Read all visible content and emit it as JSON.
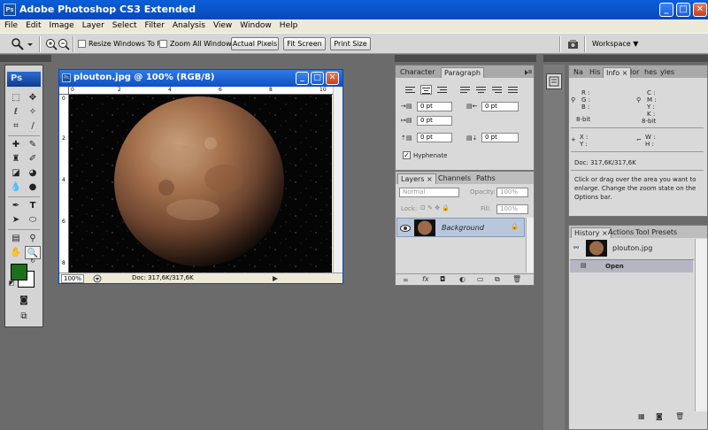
{
  "window": {
    "title": "Adobe Photoshop CS3 Extended",
    "logo": "Ps",
    "min": "_",
    "max": "□",
    "close": "✕"
  },
  "menu": [
    "File",
    "Edit",
    "Image",
    "Layer",
    "Select",
    "Filter",
    "Analysis",
    "View",
    "Window",
    "Help"
  ],
  "options": {
    "resize_windows": "Resize Windows To Fit",
    "zoom_all": "Zoom All Windows",
    "actual_pixels": "Actual Pixels",
    "fit_screen": "Fit Screen",
    "print_size": "Print Size",
    "workspace": "Workspace ▼"
  },
  "toolbox": {
    "logo": "Ps"
  },
  "document": {
    "title": "plouton.jpg @ 100% (RGB/8)",
    "zoom": "100%",
    "info": "Doc: 317,6K/317,6K",
    "ruler_h": [
      "0",
      "2",
      "4",
      "6",
      "8",
      "10"
    ],
    "ruler_v": [
      "0",
      "2",
      "4",
      "6",
      "8"
    ]
  },
  "paragraph_panel": {
    "tab_character": "Character",
    "tab_paragraph": "Paragraph",
    "indent_left": "0 pt",
    "indent_right": "0 pt",
    "indent_first": "0 pt",
    "space_before": "0 pt",
    "space_after": "0 pt",
    "hyphenate": "Hyphenate"
  },
  "layers_panel": {
    "tab_layers": "Layers ×",
    "tab_channels": "Channels",
    "tab_paths": "Paths",
    "blend_mode": "Normal",
    "opacity_label": "Opacity:",
    "opacity_value": "100%",
    "lock_label": "Lock:",
    "fill_label": "Fill:",
    "fill_value": "100%",
    "layer_name": "Background"
  },
  "info_panel": {
    "tabs": [
      "Na",
      "His",
      "Info ×",
      "lor",
      "hes",
      "yles"
    ],
    "r": "R :",
    "g": "G :",
    "b": "B :",
    "c": "C :",
    "m": "M :",
    "y": "Y :",
    "k": "K :",
    "bit_left": "8-bit",
    "bit_right": "8-bit",
    "x": "X :",
    "yy": "Y :",
    "w": "W :",
    "h": "H :",
    "doc": "Doc: 317,6K/317,6K",
    "hint": "Click or drag over the area you want to enlarge. Change the zoom state on the Options bar."
  },
  "history_panel": {
    "tab_history": "History ×",
    "tab_actions": "Actions",
    "tab_tool_presets": "Tool Presets",
    "snapshot": "plouton.jpg",
    "state": "Open"
  }
}
